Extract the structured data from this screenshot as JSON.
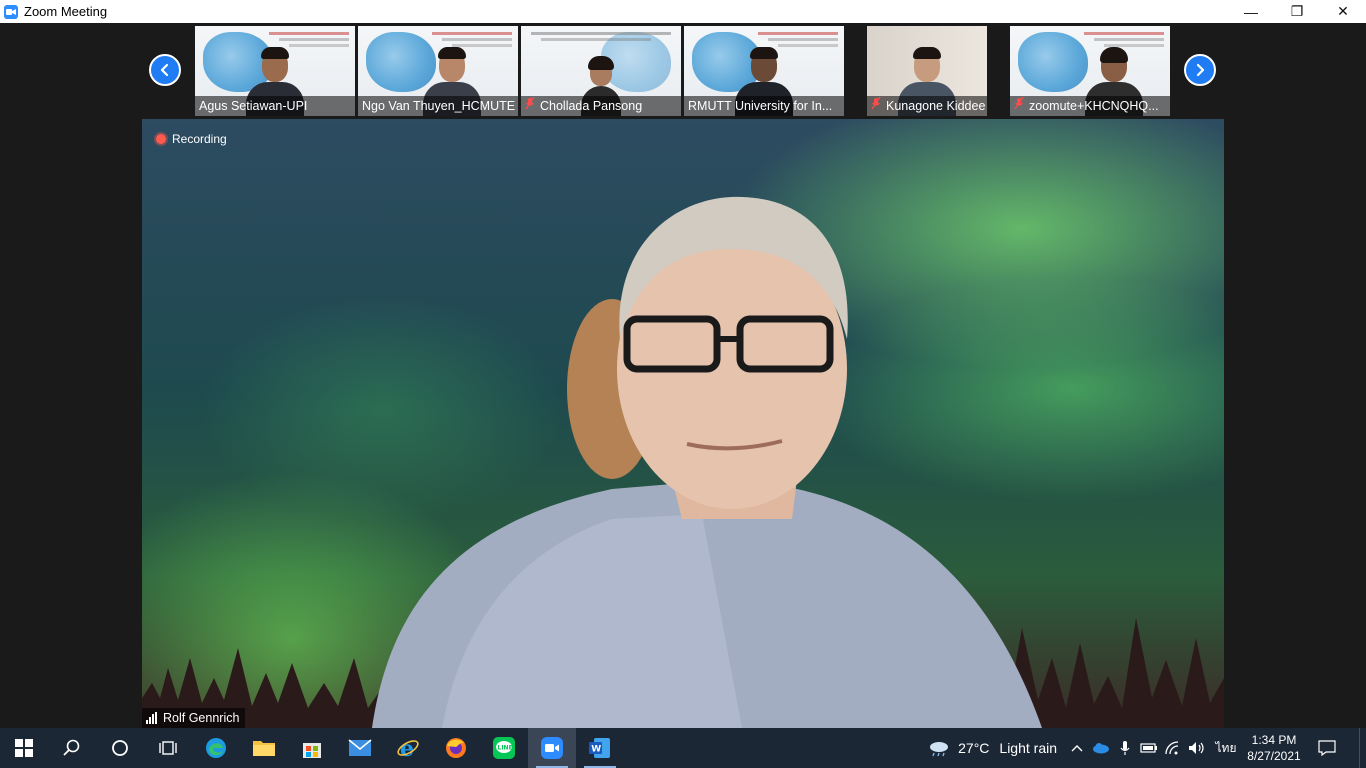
{
  "window": {
    "title": "Zoom Meeting",
    "minimize": "—",
    "restore": "❐",
    "close": "✕"
  },
  "gallery": {
    "participants": [
      {
        "name": "Agus Setiawan-UPI",
        "muted": false
      },
      {
        "name": "Ngo Van Thuyen_HCMUTE",
        "muted": false
      },
      {
        "name": "Chollada Pansong",
        "muted": true
      },
      {
        "name": "RMUTT University for In...",
        "muted": false
      },
      {
        "name": "Kunagone Kiddee",
        "muted": true
      },
      {
        "name": "zoomute+KHCNQHQ...",
        "muted": true
      }
    ]
  },
  "main_video": {
    "recording_label": "Recording",
    "speaker_name": "Rolf Gennrich"
  },
  "taskbar": {
    "apps": [
      "start-icon",
      "search-icon",
      "cortana-icon",
      "task-view-icon",
      "edge-icon",
      "file-explorer-icon",
      "store-icon",
      "mail-icon",
      "internet-explorer-icon",
      "firefox-icon",
      "line-icon",
      "zoom-icon",
      "word-icon"
    ],
    "weather_temp": "27°C",
    "weather_text": "Light rain",
    "language": "ไทย",
    "time": "1:34 PM",
    "date": "8/27/2021"
  },
  "colors": {
    "accent": "#2d8cff",
    "arrow": "#1f7cf2",
    "recording": "#ff5a4e",
    "taskbar": "#1c2735"
  }
}
